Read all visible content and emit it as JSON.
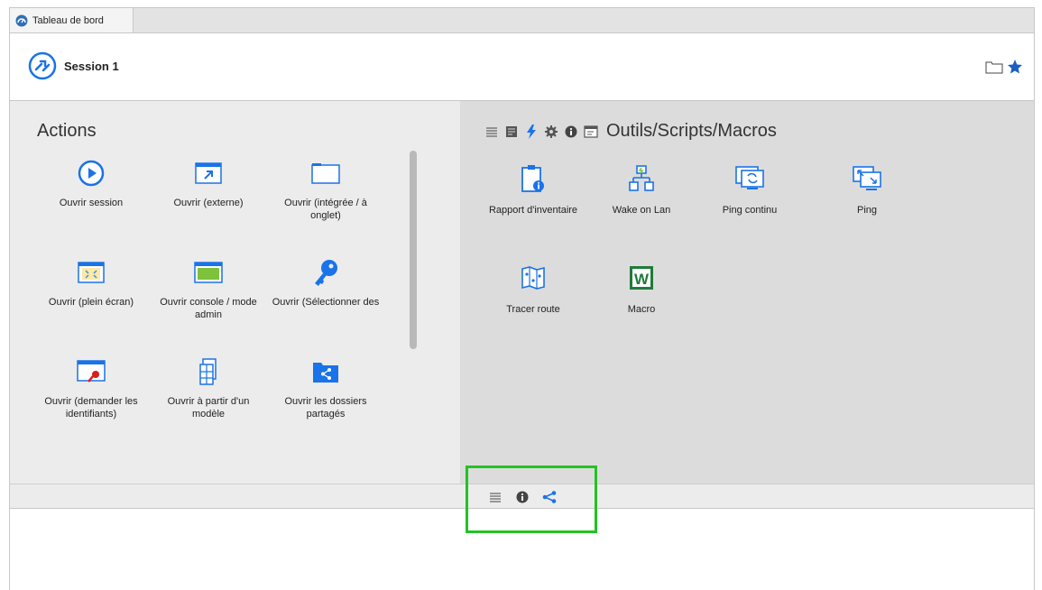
{
  "tab": {
    "label": "Tableau de bord"
  },
  "session": {
    "title": "Session 1"
  },
  "actions": {
    "title": "Actions",
    "items": [
      {
        "label": "Ouvrir session",
        "icon": "play-circle-icon"
      },
      {
        "label": "Ouvrir (externe)",
        "icon": "window-external-icon"
      },
      {
        "label": "Ouvrir (intégrée / à onglet)",
        "icon": "window-tab-icon"
      },
      {
        "label": "Ouvrir (plein écran)",
        "icon": "fullscreen-icon"
      },
      {
        "label": "Ouvrir console / mode admin",
        "icon": "console-window-icon"
      },
      {
        "label": "Ouvrir (Sélectionner des",
        "icon": "key-icon"
      },
      {
        "label": "Ouvrir (demander les identifiants)",
        "icon": "window-key-icon"
      },
      {
        "label": "Ouvrir à partir d'un modèle",
        "icon": "template-icon"
      },
      {
        "label": "Ouvrir les dossiers partagés",
        "icon": "shared-folder-icon"
      }
    ]
  },
  "tools": {
    "title": "Outils/Scripts/Macros",
    "items": [
      {
        "label": "Rapport d'inventaire",
        "icon": "clipboard-info-icon"
      },
      {
        "label": "Wake on Lan",
        "icon": "network-icon"
      },
      {
        "label": "Ping continu",
        "icon": "monitor-refresh-icon"
      },
      {
        "label": "Ping",
        "icon": "monitor-arrows-icon"
      },
      {
        "label": "Tracer route",
        "icon": "map-route-icon"
      },
      {
        "label": "Macro",
        "icon": "word-macro-icon"
      }
    ],
    "macro_letter": "W"
  },
  "colors": {
    "accent": "#1a73e8",
    "highlight": "#22c322"
  }
}
